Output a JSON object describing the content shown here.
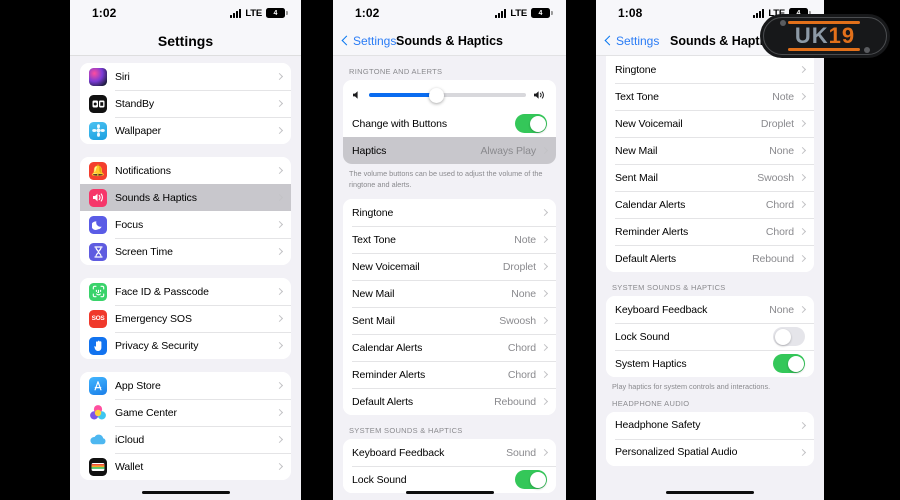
{
  "watermark": {
    "text_left": "UK",
    "text_right": "19"
  },
  "phone1": {
    "status": {
      "time": "1:02",
      "network": "LTE",
      "battery": "4"
    },
    "title": "Settings",
    "groups": [
      {
        "rows": [
          {
            "label": "Siri",
            "icon": "siri-icon",
            "chevron": true
          },
          {
            "label": "StandBy",
            "icon": "standby-icon",
            "chevron": true
          },
          {
            "label": "Wallpaper",
            "icon": "wallpaper-icon",
            "chevron": true
          }
        ]
      },
      {
        "rows": [
          {
            "label": "Notifications",
            "icon": "notifications-icon",
            "chevron": true
          },
          {
            "label": "Sounds & Haptics",
            "icon": "sounds-haptics-icon",
            "chevron": true,
            "selected": true
          },
          {
            "label": "Focus",
            "icon": "focus-icon",
            "chevron": true
          },
          {
            "label": "Screen Time",
            "icon": "screen-time-icon",
            "chevron": true
          }
        ]
      },
      {
        "rows": [
          {
            "label": "Face ID & Passcode",
            "icon": "face-id-icon",
            "chevron": true
          },
          {
            "label": "Emergency SOS",
            "icon": "emergency-sos-icon",
            "chevron": true
          },
          {
            "label": "Privacy & Security",
            "icon": "privacy-security-icon",
            "chevron": true
          }
        ]
      },
      {
        "rows": [
          {
            "label": "App Store",
            "icon": "app-store-icon",
            "chevron": true
          },
          {
            "label": "Game Center",
            "icon": "game-center-icon",
            "chevron": true
          },
          {
            "label": "iCloud",
            "icon": "icloud-icon",
            "chevron": true
          },
          {
            "label": "Wallet",
            "icon": "wallet-icon",
            "chevron": true
          }
        ]
      }
    ]
  },
  "phone2": {
    "status": {
      "time": "1:02",
      "network": "LTE",
      "battery": "4"
    },
    "back_label": "Settings",
    "title": "Sounds & Haptics",
    "section1_header": "RINGTONE AND ALERTS",
    "volume": {
      "percent": 43,
      "min_icon": "speaker-low-icon",
      "max_icon": "speaker-high-icon"
    },
    "change_with_buttons": {
      "label": "Change with Buttons",
      "on": true
    },
    "haptics": {
      "label": "Haptics",
      "value": "Always Play"
    },
    "section1_footer": "The volume buttons can be used to adjust the volume of the ringtone and alerts.",
    "tones": [
      {
        "label": "Ringtone",
        "value": ""
      },
      {
        "label": "Text Tone",
        "value": "Note"
      },
      {
        "label": "New Voicemail",
        "value": "Droplet"
      },
      {
        "label": "New Mail",
        "value": "None"
      },
      {
        "label": "Sent Mail",
        "value": "Swoosh"
      },
      {
        "label": "Calendar Alerts",
        "value": "Chord"
      },
      {
        "label": "Reminder Alerts",
        "value": "Chord"
      },
      {
        "label": "Default Alerts",
        "value": "Rebound"
      }
    ],
    "section2_header": "SYSTEM SOUNDS & HAPTICS",
    "system": [
      {
        "label": "Keyboard Feedback",
        "value": "Sound",
        "type": "link"
      },
      {
        "label": "Lock Sound",
        "type": "toggle",
        "on": true
      }
    ]
  },
  "phone3": {
    "status": {
      "time": "1:08",
      "network": "LTE",
      "battery": "4"
    },
    "back_label": "Settings",
    "title": "Sounds & Haptics",
    "tones": [
      {
        "label": "Ringtone",
        "value": ""
      },
      {
        "label": "Text Tone",
        "value": "Note"
      },
      {
        "label": "New Voicemail",
        "value": "Droplet"
      },
      {
        "label": "New Mail",
        "value": "None"
      },
      {
        "label": "Sent Mail",
        "value": "Swoosh"
      },
      {
        "label": "Calendar Alerts",
        "value": "Chord"
      },
      {
        "label": "Reminder Alerts",
        "value": "Chord"
      },
      {
        "label": "Default Alerts",
        "value": "Rebound"
      }
    ],
    "section2_header": "SYSTEM SOUNDS & HAPTICS",
    "system": [
      {
        "label": "Keyboard Feedback",
        "value": "None",
        "type": "link"
      },
      {
        "label": "Lock Sound",
        "type": "toggle",
        "on": false
      },
      {
        "label": "System Haptics",
        "type": "toggle",
        "on": true
      }
    ],
    "section2_footer": "Play haptics for system controls and interactions.",
    "section3_header": "HEADPHONE AUDIO",
    "headphone": [
      {
        "label": "Headphone Safety"
      },
      {
        "label": "Personalized Spatial Audio"
      }
    ]
  }
}
